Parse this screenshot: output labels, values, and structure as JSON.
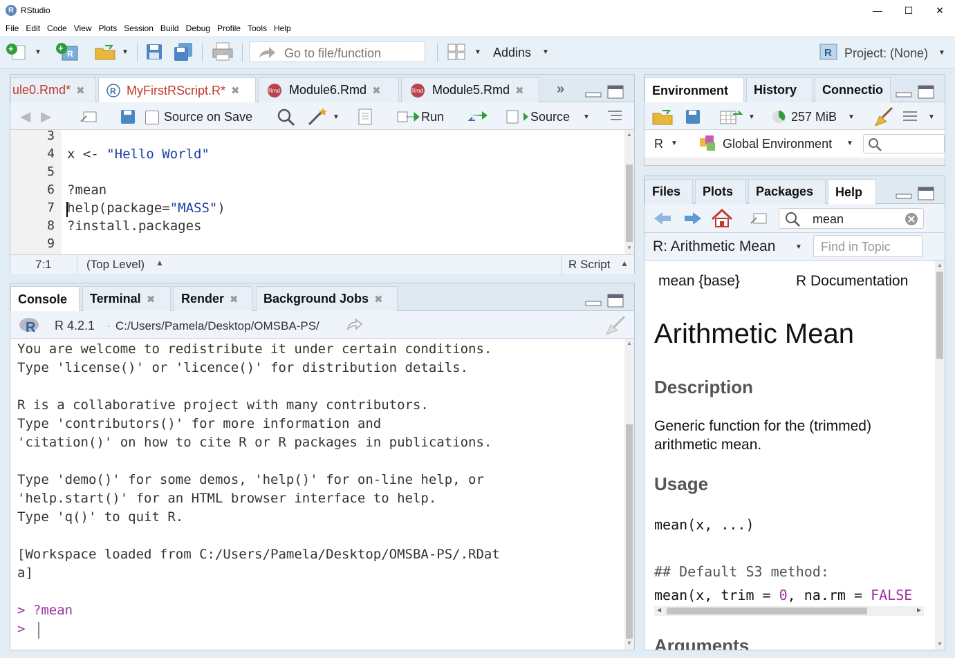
{
  "window": {
    "title": "RStudio"
  },
  "menu": [
    "File",
    "Edit",
    "Code",
    "View",
    "Plots",
    "Session",
    "Build",
    "Debug",
    "Profile",
    "Tools",
    "Help"
  ],
  "toolbar": {
    "goto_placeholder": "Go to file/function",
    "addins_label": "Addins",
    "project_label": "Project: (None)"
  },
  "editor": {
    "tabs": [
      {
        "label": "ule0.Rmd*"
      },
      {
        "label": "MyFirstRScript.R*"
      },
      {
        "label": "Module6.Rmd"
      },
      {
        "label": "Module5.Rmd"
      }
    ],
    "toolbar": {
      "source_on_save": "Source on Save",
      "run_label": "Run",
      "source_label": "Source"
    },
    "line_numbers": [
      "3",
      "4",
      "5",
      "6",
      "7",
      "8",
      "9"
    ],
    "lines": [
      "",
      "x <- ",
      "",
      "?mean",
      "help(package=",
      "?install.packages",
      ""
    ],
    "line4_string": "\"Hello World\"",
    "line7_string": "\"MASS\"",
    "line7_end": ")",
    "status": {
      "position": "7:1",
      "scope": "(Top Level)",
      "filetype": "R Script"
    }
  },
  "console": {
    "tabs": [
      {
        "label": "Console"
      },
      {
        "label": "Terminal"
      },
      {
        "label": "Render"
      },
      {
        "label": "Background Jobs"
      }
    ],
    "version": "R 4.2.1",
    "path": "C:/Users/Pamela/Desktop/OMSBA-PS/",
    "lines": [
      "You are welcome to redistribute it under certain conditions.",
      "Type 'license()' or 'licence()' for distribution details.",
      "",
      "R is a collaborative project with many contributors.",
      "Type 'contributors()' for more information and",
      "'citation()' on how to cite R or R packages in publications.",
      "",
      "Type 'demo()' for some demos, 'help()' for on-line help, or",
      "'help.start()' for an HTML browser interface to help.",
      "Type 'q()' to quit R.",
      "",
      "[Workspace loaded from C:/Users/Pamela/Desktop/OMSBA-PS/.RDat",
      "a]",
      ""
    ],
    "prompt_symbol": ">",
    "prompt_history": "?mean"
  },
  "environment": {
    "tabs": [
      {
        "label": "Environment"
      },
      {
        "label": "History"
      },
      {
        "label": "Connectio"
      }
    ],
    "memory": "257 MiB",
    "language": "R",
    "scope": "Global Environment"
  },
  "help": {
    "tabs": [
      {
        "label": "Files"
      },
      {
        "label": "Plots"
      },
      {
        "label": "Packages"
      },
      {
        "label": "Help"
      }
    ],
    "search_value": "mean",
    "topic_title": "R: Arithmetic Mean",
    "find_placeholder": "Find in Topic",
    "doc_left": "mean {base}",
    "doc_right": "R Documentation",
    "heading": "Arithmetic Mean",
    "description_heading": "Description",
    "description_text": "Generic function for the (trimmed) arithmetic mean.",
    "usage_heading": "Usage",
    "usage_line": "mean(x, ...)",
    "default_comment": "## Default S3 method:",
    "default_code_a": "mean(x, trim = ",
    "default_code_num": "0",
    "default_code_b": ", na.rm = ",
    "default_code_false": "FALSE",
    "arguments_heading": "Arguments"
  },
  "colors": {
    "accent": "#d9534f",
    "string": "#1a3fa6",
    "prompt": "#9a2fa0"
  }
}
